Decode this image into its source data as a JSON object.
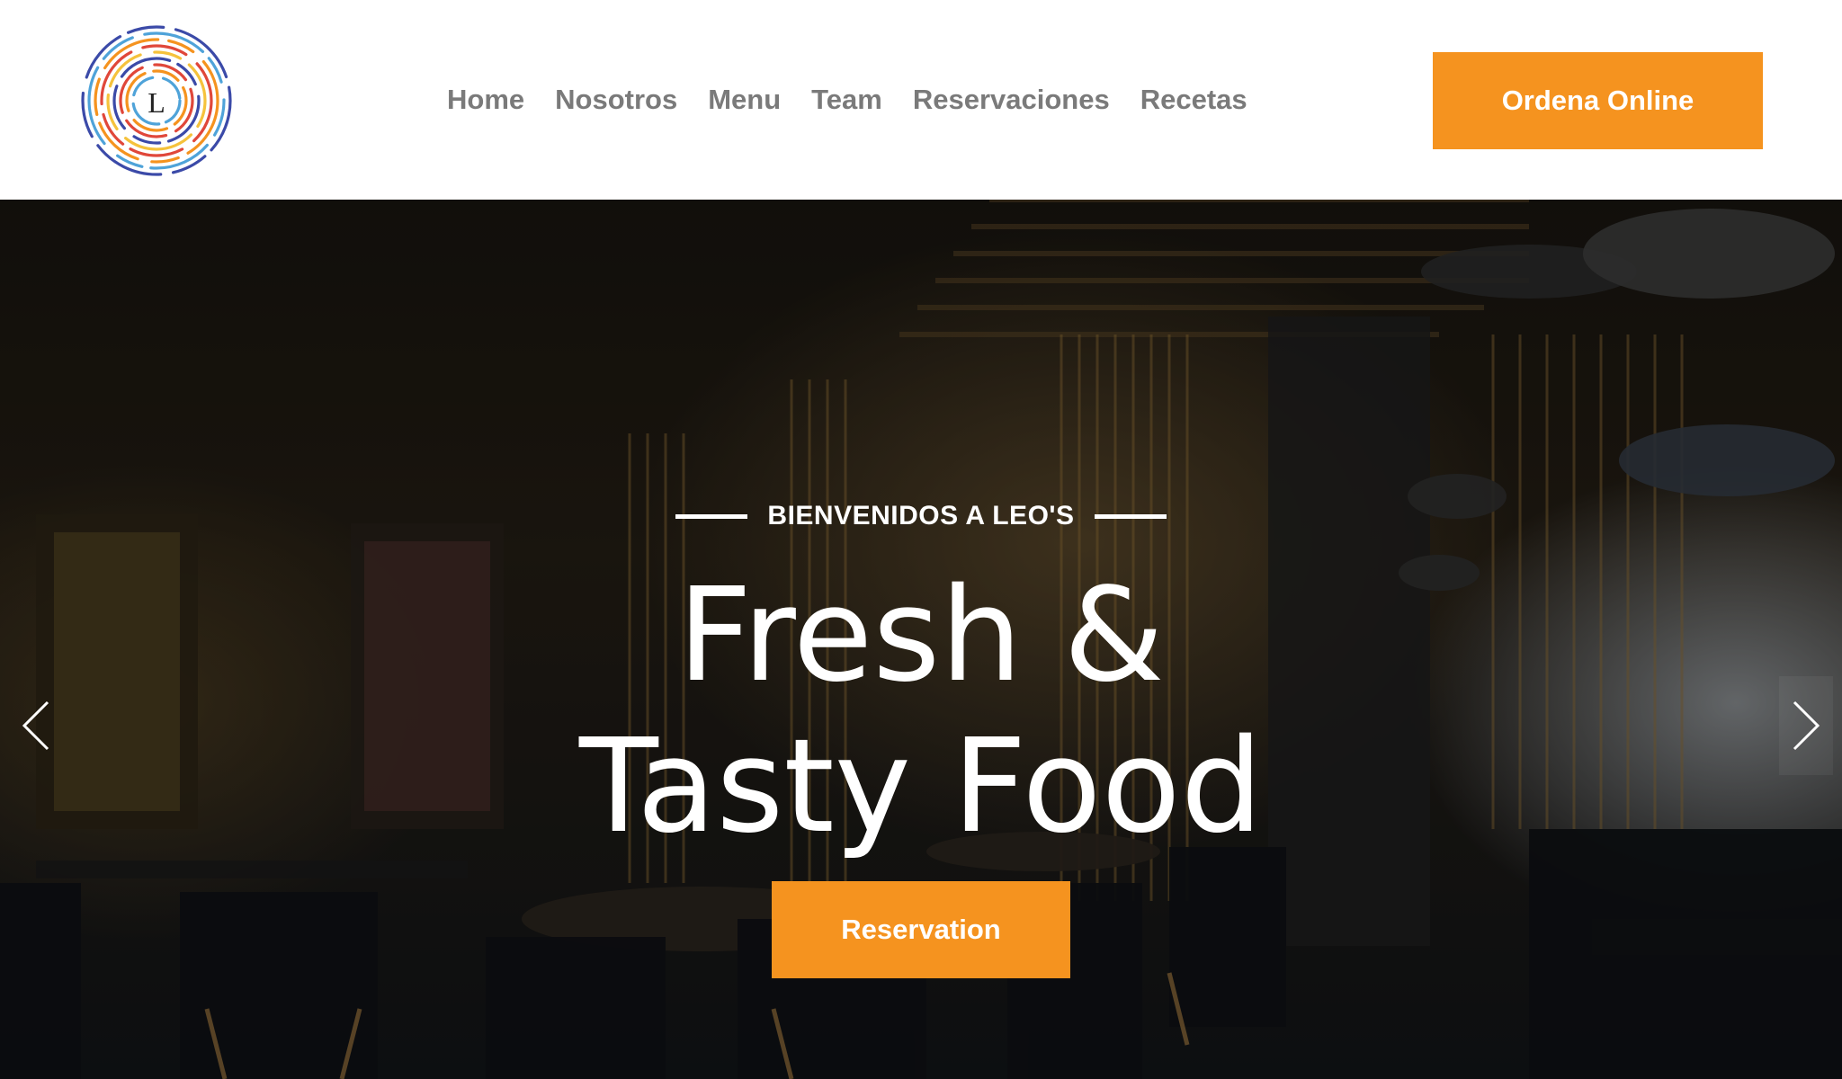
{
  "colors": {
    "accent": "#f5931f",
    "nav_text": "#7a7a7a",
    "header_bg": "#ffffff",
    "hero_text": "#ffffff"
  },
  "header": {
    "logo": {
      "icon": "concentric-rings-logo",
      "letter": "L"
    },
    "nav": [
      {
        "label": "Home"
      },
      {
        "label": "Nosotros"
      },
      {
        "label": "Menu"
      },
      {
        "label": "Team"
      },
      {
        "label": "Reservaciones"
      },
      {
        "label": "Recetas"
      }
    ],
    "order_button": "Ordena Online"
  },
  "hero": {
    "eyebrow": "BIENVENIDOS A LEO'S",
    "title_line1": "Fresh &",
    "title_line2": "Tasty Food",
    "button": "Reservation",
    "prev_icon": "chevron-left-icon",
    "next_icon": "chevron-right-icon"
  }
}
